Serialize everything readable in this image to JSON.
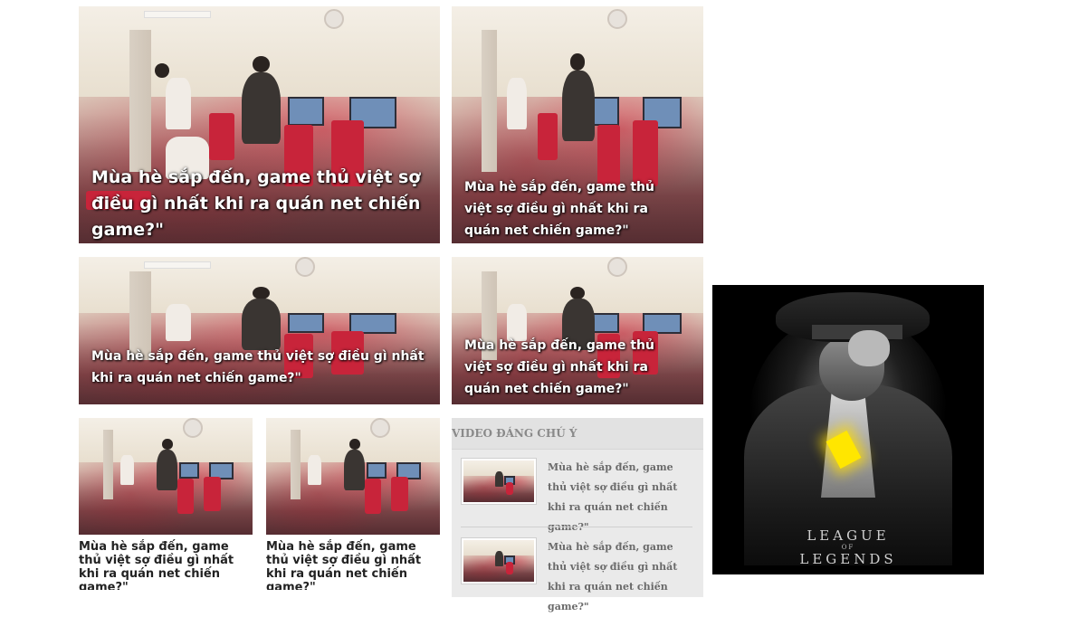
{
  "articles": {
    "featured_1": {
      "title": "Mùa hè sắp đến, game thủ việt sợ điều gì nhất khi ra quán net chiến game?\""
    },
    "featured_2": {
      "title": "Mùa hè sắp đến, game thủ việt sợ điều gì nhất khi ra quán net chiến game?\""
    },
    "featured_3": {
      "title": "Mùa hè sắp đến, game thủ việt sợ điều gì nhất khi ra quán net chiến game?\""
    },
    "featured_4": {
      "title": "Mùa hè sắp đến, game thủ việt sợ điều gì nhất khi ra quán net chiến game?\""
    },
    "small_1": {
      "title": "Mùa hè sắp đến, game thủ việt sợ điều gì nhất khi ra quán net chiến game?\""
    },
    "small_2": {
      "title": "Mùa hè sắp đến, game thủ việt sợ điều gì nhất khi ra quán net chiến game?\""
    }
  },
  "video_section": {
    "heading": "VIDEO ĐÁNG CHÚ Ý",
    "items": [
      {
        "title": "Mùa hè sắp đến, game thủ việt sợ điều gì nhất khi ra quán net chiến game?\""
      },
      {
        "title": "Mùa hè sắp đến, game thủ việt sợ điều gì nhất khi ra quán net chiến game?\""
      }
    ]
  },
  "ad_banner": {
    "logo_line1": "LEAGUE",
    "logo_line2": "OF",
    "logo_line3": "LEGENDS"
  }
}
